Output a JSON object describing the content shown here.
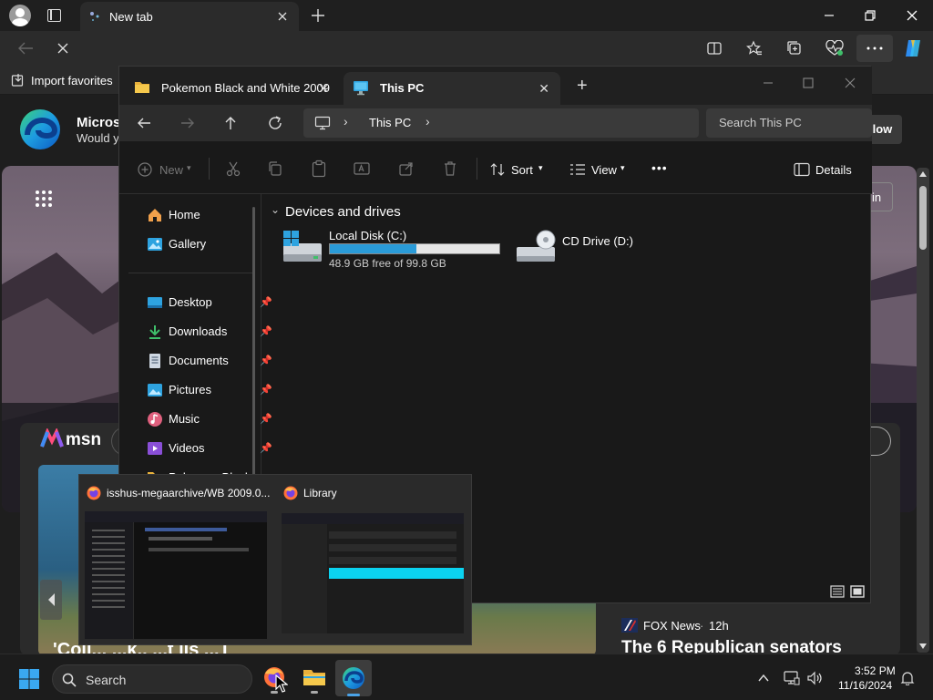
{
  "edge": {
    "tab_title": "New tab",
    "favorites_import_label": "Import favorites",
    "window_controls": [
      "minimize",
      "restore",
      "close"
    ],
    "toolbar_icons": [
      "split-screen-icon",
      "favorites-icon",
      "collections-icon",
      "browser-essentials-icon",
      "more-options-icon",
      "copilot-icon"
    ]
  },
  "ntp": {
    "profile_name_partial": "Microso",
    "subtext_partial": "Would y",
    "follow_button_partial": "llow",
    "signin_partial": "in",
    "apps_grid_icon": "apps-grid-icon",
    "msn_label": "msn",
    "news": {
      "source": "FOX News",
      "age": "12h",
      "headline_partial": "The 6 Republican senators",
      "left_headline_partial": "'Coll...        ...k..   ...t lls    ...T"
    }
  },
  "explorer": {
    "tabs": [
      {
        "label": "Pokemon Black and White 2009",
        "active": false
      },
      {
        "label": "This PC",
        "active": true
      }
    ],
    "new_tab_label": "+",
    "breadcrumb": [
      "This PC"
    ],
    "search_placeholder": "Search This PC",
    "commands": {
      "new": "New",
      "sort": "Sort",
      "view": "View",
      "more": "•••",
      "details": "Details"
    },
    "sidebar": [
      {
        "label": "Home",
        "icon": "home-icon",
        "pinned": false
      },
      {
        "label": "Gallery",
        "icon": "gallery-icon",
        "pinned": false
      },
      {
        "label": "Desktop",
        "icon": "desktop-icon",
        "pinned": true
      },
      {
        "label": "Downloads",
        "icon": "downloads-icon",
        "pinned": true
      },
      {
        "label": "Documents",
        "icon": "documents-icon",
        "pinned": true
      },
      {
        "label": "Pictures",
        "icon": "pictures-icon",
        "pinned": true
      },
      {
        "label": "Music",
        "icon": "music-icon",
        "pinned": true
      },
      {
        "label": "Videos",
        "icon": "videos-icon",
        "pinned": true
      },
      {
        "label": "Pokemon Black...",
        "icon": "folder-icon",
        "pinned": true
      }
    ],
    "section_title": "Devices and drives",
    "drives": [
      {
        "name": "Local Disk (C:)",
        "free_text": "48.9 GB free of 99.8 GB",
        "used_fraction": 0.51
      },
      {
        "name": "CD Drive (D:)"
      }
    ]
  },
  "taskbar": {
    "search_label": "Search",
    "time": "3:52 PM",
    "date": "11/16/2024",
    "thumbnails": [
      {
        "title": "isshus-megaarchive/WB 2009.0..."
      },
      {
        "title": "Library"
      }
    ]
  },
  "colors": {
    "accent": "#4aa3e8",
    "progress_fill": "#2a9bd8",
    "edge_bg": "#2b2b2b",
    "explorer_bg": "#191919"
  }
}
